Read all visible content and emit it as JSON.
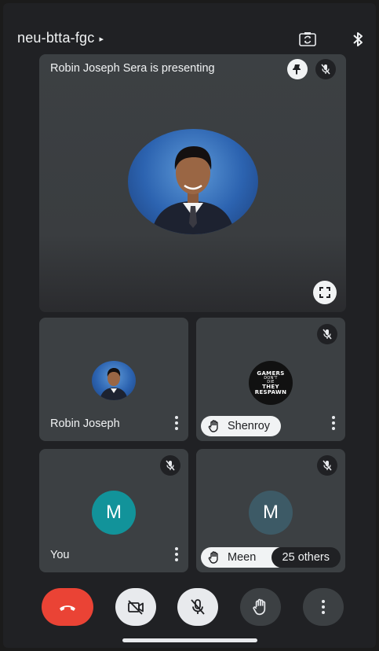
{
  "header": {
    "meeting_code": "neu-btta-fgc",
    "caret": "▸",
    "icons": [
      "switch-camera-icon",
      "bluetooth-icon"
    ]
  },
  "main_tile": {
    "presenting_text": "Robin Joseph Sera is presenting",
    "icons": [
      "pin-icon",
      "mic-off-icon",
      "fullscreen-icon"
    ]
  },
  "participants": [
    {
      "name": "Robin Joseph",
      "avatar": "photo",
      "muted": false
    },
    {
      "name": "Shenroy",
      "avatar": "gamer-logo",
      "hand_raised": true,
      "muted": true,
      "logo_text": [
        "GAMERS",
        "DON'T",
        "DIE",
        "THEY",
        "RESPAWN"
      ]
    },
    {
      "name": "You",
      "avatar_letter": "M",
      "avatar_color": "#12939a",
      "muted": true
    },
    {
      "name": "Meen",
      "avatar_letter": "M",
      "avatar_color": "#3d5a66",
      "muted": true,
      "hand_raised": true,
      "others_label": "25 others"
    }
  ],
  "controls": [
    "end-call-button",
    "camera-off-button",
    "mic-off-button",
    "raise-hand-button",
    "more-options-button"
  ],
  "colors": {
    "background": "#202124",
    "tile": "#3c4043",
    "end_call": "#ea4335",
    "control_light": "#e8eaed"
  }
}
